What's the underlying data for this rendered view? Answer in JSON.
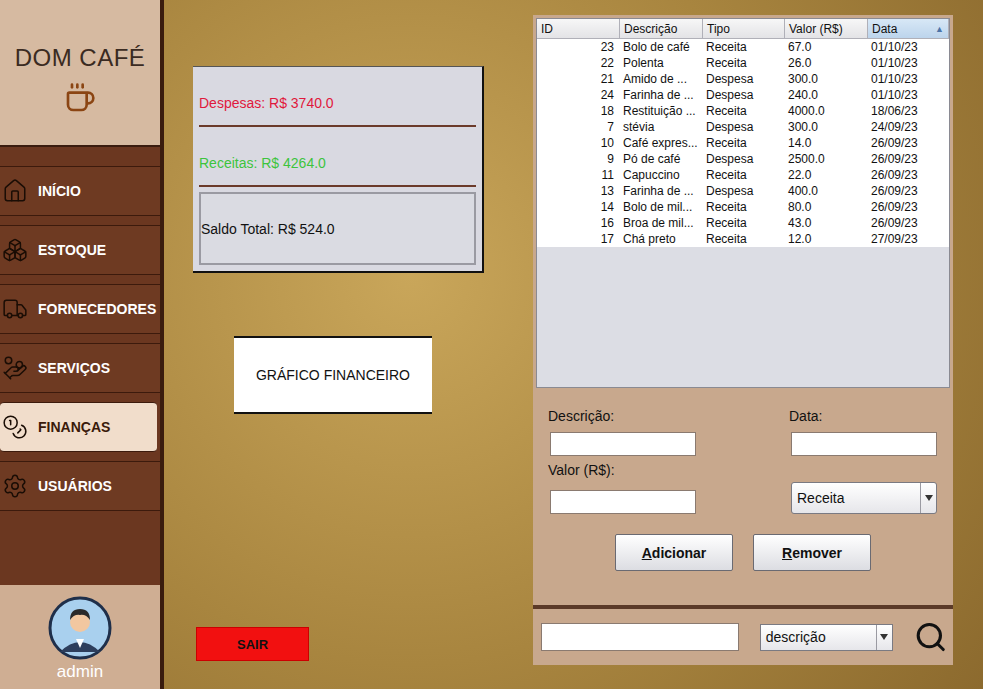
{
  "app": {
    "title": "DOM CAFÉ",
    "user": "admin"
  },
  "sidebar": {
    "items": [
      {
        "label": "INÍCIO",
        "selected": false
      },
      {
        "label": "ESTOQUE",
        "selected": false
      },
      {
        "label": "FORNECEDORES",
        "selected": false
      },
      {
        "label": "SERVIÇOS",
        "selected": false
      },
      {
        "label": "FINANÇAS",
        "selected": true
      },
      {
        "label": "USUÁRIOS",
        "selected": false
      }
    ]
  },
  "summary": {
    "expenses": "Despesas: R$ 3740.0",
    "income": "Receitas: R$ 4264.0",
    "balance": "Saldo Total: R$ 524.0"
  },
  "chart_button": "GRÁFICO FINANCEIRO",
  "exit_button": "SAIR",
  "table": {
    "columns": [
      {
        "label": "ID",
        "sorted": false,
        "sort_icon": ""
      },
      {
        "label": "Descrição",
        "sorted": false,
        "sort_icon": ""
      },
      {
        "label": "Tipo",
        "sorted": false,
        "sort_icon": ""
      },
      {
        "label": "Valor (R$)",
        "sorted": false,
        "sort_icon": ""
      },
      {
        "label": "Data",
        "sorted": true,
        "sort_icon": "▲"
      }
    ],
    "rows": [
      [
        "23",
        "Bolo de café",
        "Receita",
        "67.0",
        "01/10/23"
      ],
      [
        "22",
        "Polenta",
        "Receita",
        "26.0",
        "01/10/23"
      ],
      [
        "21",
        "Amido de ...",
        "Despesa",
        "300.0",
        "01/10/23"
      ],
      [
        "24",
        "Farinha de ...",
        "Despesa",
        "240.0",
        "01/10/23"
      ],
      [
        "18",
        "Restituição ...",
        "Receita",
        "4000.0",
        "18/06/23"
      ],
      [
        "7",
        "stévia",
        "Despesa",
        "300.0",
        "24/09/23"
      ],
      [
        "10",
        "Café expres...",
        "Receita",
        "14.0",
        "26/09/23"
      ],
      [
        "9",
        "Pó de café",
        "Despesa",
        "2500.0",
        "26/09/23"
      ],
      [
        "11",
        "Capuccino",
        "Receita",
        "22.0",
        "26/09/23"
      ],
      [
        "13",
        "Farinha de ...",
        "Despesa",
        "400.0",
        "26/09/23"
      ],
      [
        "14",
        "Bolo de mil...",
        "Receita",
        "80.0",
        "26/09/23"
      ],
      [
        "16",
        "Broa de mil...",
        "Receita",
        "43.0",
        "26/09/23"
      ],
      [
        "17",
        "Chá preto",
        "Receita",
        "12.0",
        "27/09/23"
      ]
    ]
  },
  "form": {
    "description_label": "Descrição:",
    "date_label": "Data:",
    "value_label": "Valor (R$):",
    "type_select": "Receita",
    "buttons": [
      "Adicionar",
      "Remover"
    ]
  },
  "search": {
    "field_select": "descrição"
  }
}
